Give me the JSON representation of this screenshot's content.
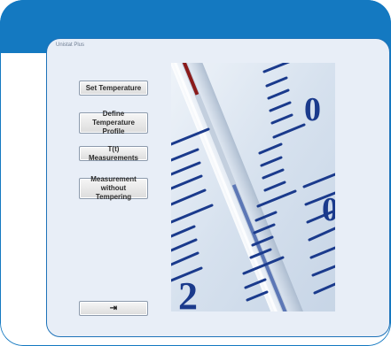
{
  "window": {
    "title": "Unistat Plus"
  },
  "buttons": {
    "set_temperature": "Set Temperature",
    "define_line1": "Define Temperature",
    "define_line2": "Profile",
    "t_measurements": "T(t) Measurements",
    "mwt_line1": "Measurement without",
    "mwt_line2": "Tempering",
    "exit_icon": "exit-icon"
  },
  "thermometer": {
    "scale_labels": [
      "0",
      "0",
      "2"
    ]
  },
  "colors": {
    "accent": "#1479c1",
    "window_bg": "#e8eef7",
    "scale_ink": "#1a3a8c",
    "mercury_red": "#8a1a1a"
  }
}
